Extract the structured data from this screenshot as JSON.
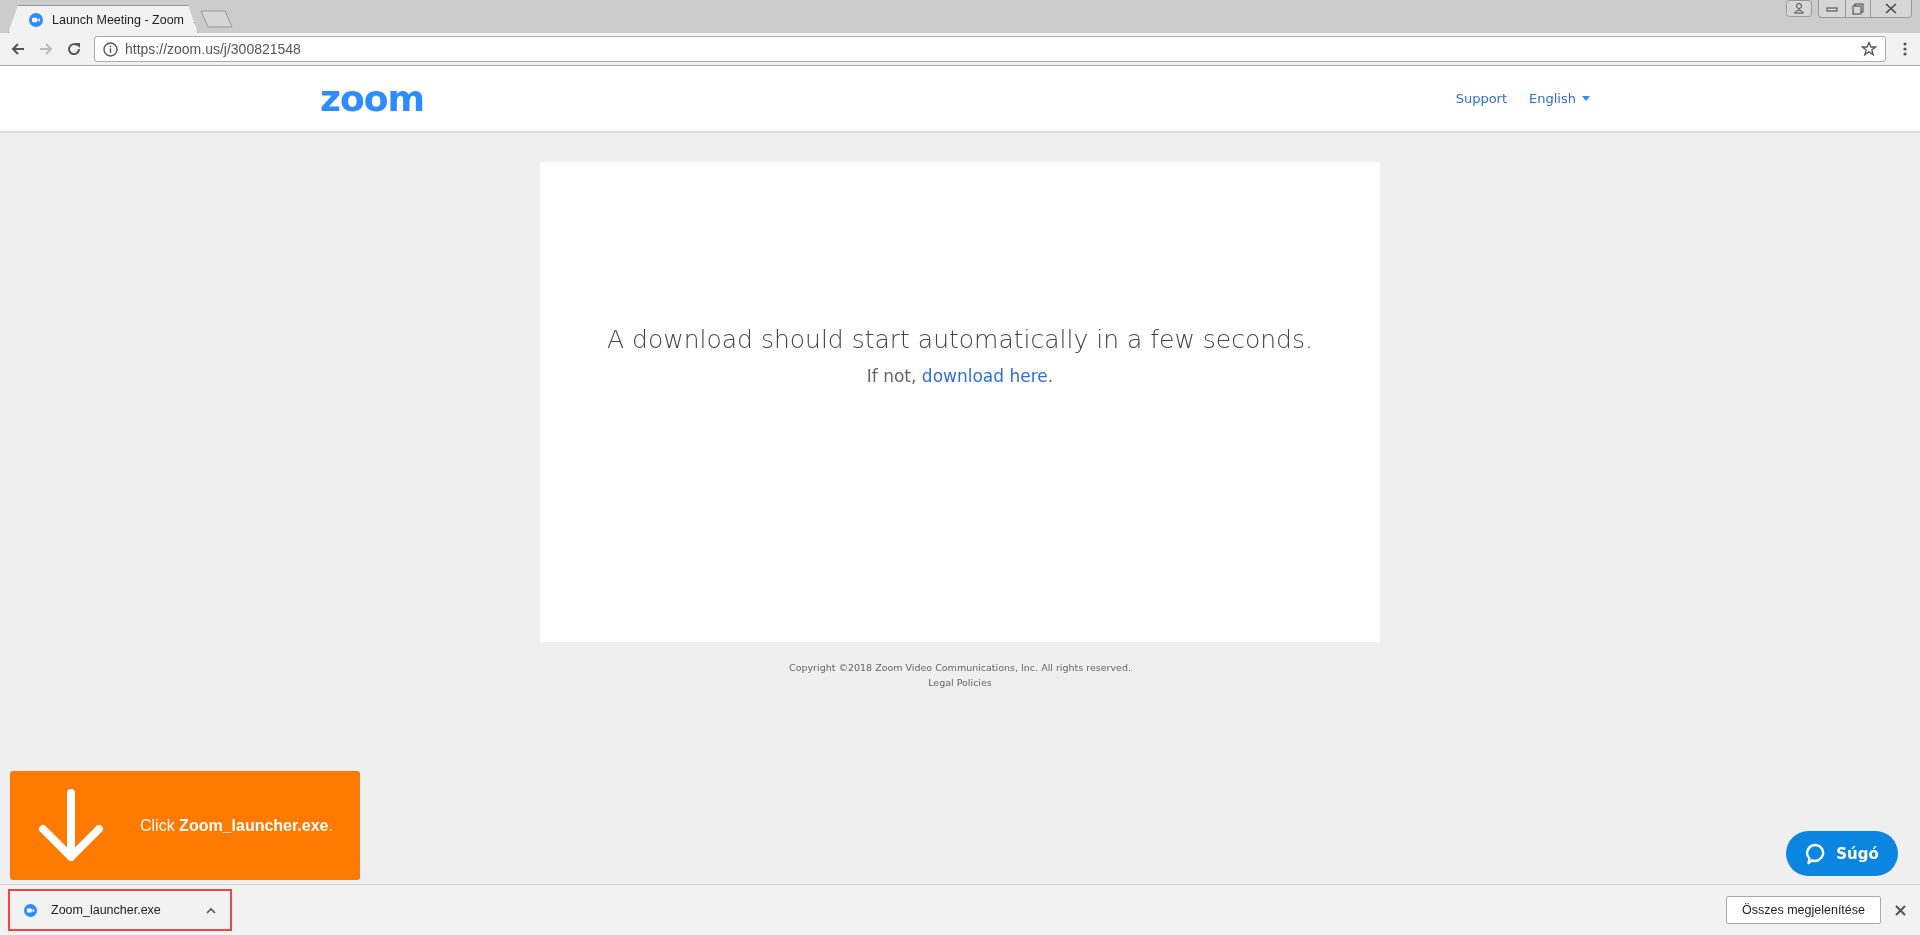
{
  "browser": {
    "tabs": [
      {
        "title": "Launch Meeting - Zoom",
        "selected": true
      }
    ],
    "address_bar": {
      "url": "https://zoom.us/j/300821548"
    }
  },
  "header": {
    "logo": "zoom",
    "nav": [
      {
        "label": "Support",
        "kind": "link"
      },
      {
        "label": "English",
        "kind": "dropdown"
      }
    ]
  },
  "card": {
    "headline": "A download should start automatically in a few seconds.",
    "note": {
      "prefix": "If not, ",
      "link": "download here",
      "suffix": "."
    }
  },
  "footer": {
    "copyright": "Copyright ©2018 Zoom Video Communications, Inc. All rights reserved.",
    "legal": "Legal Policies"
  },
  "banner": {
    "text": "Click **Zoom_launcher.exe**."
  },
  "help_button": {
    "label": "Súgó"
  },
  "download_shelf": {
    "items": [
      {
        "file": "Zoom_launcher.exe",
        "highlighted": true
      }
    ],
    "show_all": "Összes megjelenítése"
  }
}
